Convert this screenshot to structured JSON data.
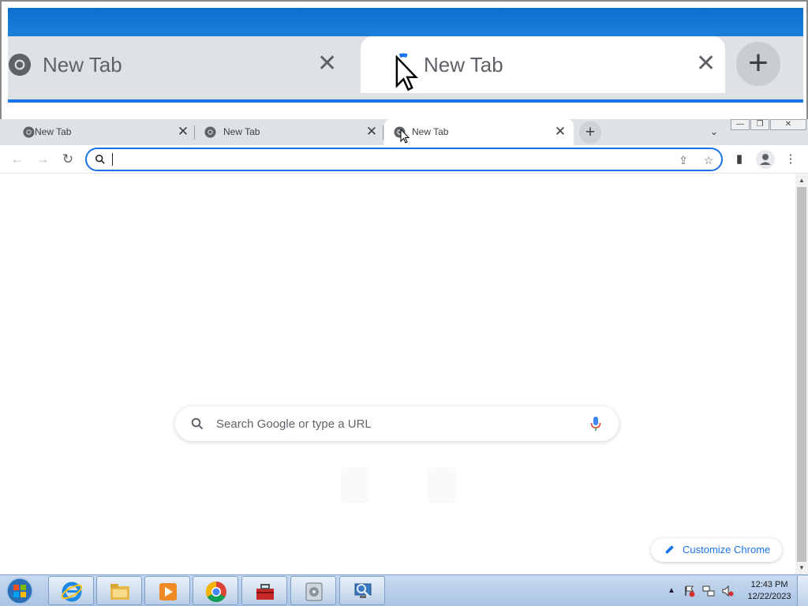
{
  "magnifier": {
    "tabs": [
      {
        "title": "New Tab",
        "close": "✕"
      },
      {
        "title": "New Tab",
        "close": "✕"
      }
    ],
    "new_tab": "+"
  },
  "browser": {
    "tabs": [
      {
        "title": "New Tab",
        "close": "✕",
        "active": false
      },
      {
        "title": "New Tab",
        "close": "✕",
        "active": false
      },
      {
        "title": "New Tab",
        "close": "✕",
        "active": true
      }
    ],
    "new_tab": "+",
    "tab_search": "⌄",
    "window_buttons": {
      "minimize": "—",
      "maximize": "❐",
      "close": "✕"
    },
    "nav": {
      "back": "←",
      "forward": "→",
      "reload": "↻"
    },
    "omnibox": {
      "value": "",
      "placeholder": ""
    },
    "toolbar": {
      "share": "⇪",
      "bookmark": "☆",
      "side_panel": "▮",
      "menu": "⋮"
    }
  },
  "page": {
    "search_placeholder": "Search Google or type a URL",
    "customize_label": "Customize Chrome"
  },
  "scrollbar": {
    "up": "▲",
    "down": "▼"
  },
  "taskbar": {
    "apps": [
      "internet-explorer",
      "file-explorer",
      "media-player",
      "chrome",
      "toolbox",
      "disk-utility",
      "network-search"
    ],
    "clock_time": "12:43 PM",
    "clock_date": "12/22/2023",
    "tray_arrow": "▲"
  },
  "colors": {
    "accent": "#1a73e8",
    "tab_strip": "#dee1e6",
    "taskbar": "#b8cfea"
  }
}
